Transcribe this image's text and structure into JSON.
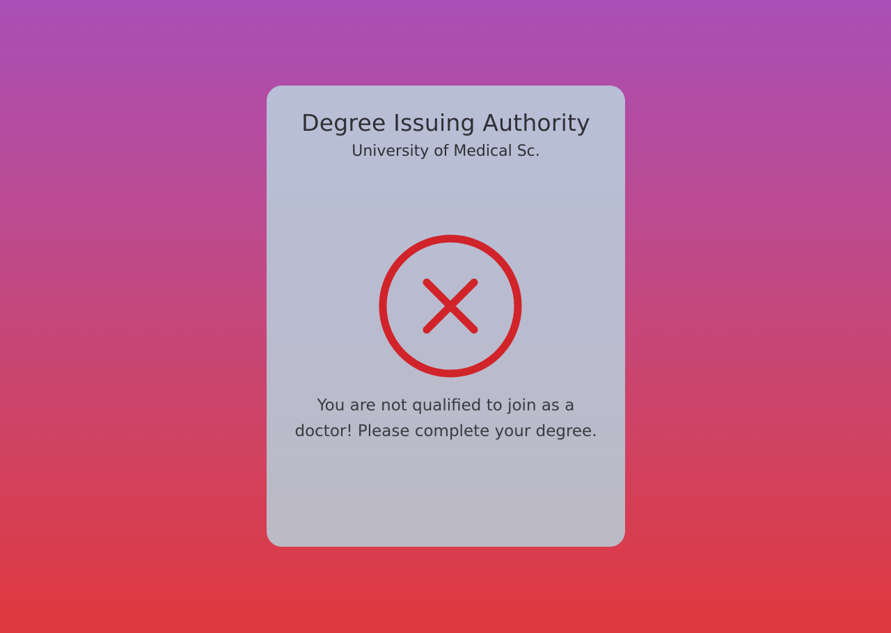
{
  "dialog": {
    "title": "Degree Issuing Authority",
    "subtitle": "University of Medical Sc.",
    "status_icon": "close-circle-icon",
    "message_line1": "You are not qualified to join as a",
    "message_line2": "doctor! Please complete your degree."
  },
  "colors": {
    "error_red": "#d0242a",
    "background_top": "#a94fb7",
    "background_bottom": "#df383d",
    "card_background": "#b9bdd0"
  }
}
